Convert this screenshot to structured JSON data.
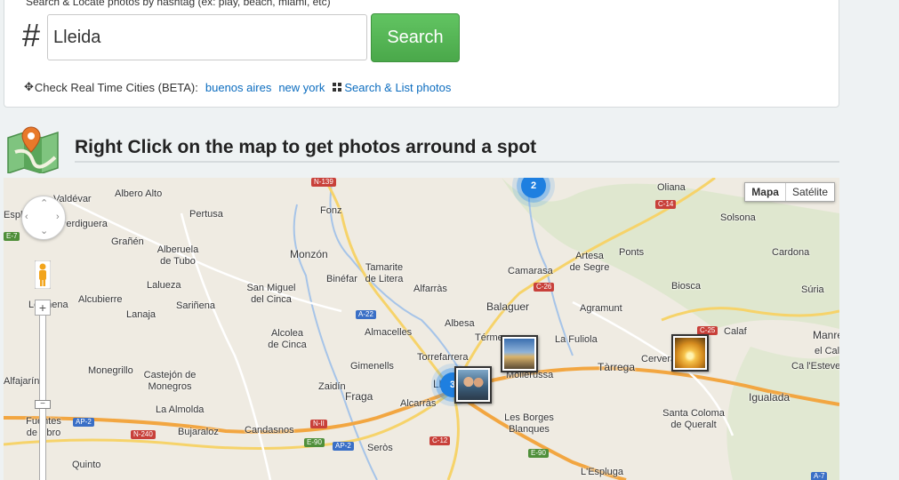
{
  "search": {
    "hint": "Search & Locate photos by hashtag (ex: play, beach, miami, etc)",
    "hash_symbol": "#",
    "value": "Lleida",
    "button": "Search"
  },
  "cities": {
    "label": "Check Real Time Cities (BETA):",
    "items": [
      "buenos aires",
      "new york"
    ],
    "list_link": "Search & List photos"
  },
  "section": {
    "title": "Right Click on the map to get photos arround a spot"
  },
  "map": {
    "type_buttons": [
      "Mapa",
      "Satélite"
    ],
    "zoom_in": "+",
    "zoom_out": "−",
    "places": [
      "Albero Alto",
      "Pertusa",
      "Fonz",
      "Oliana",
      "Solsona",
      "Grañén",
      "Alberuela de Tubo",
      "Monzón",
      "Tamarite de Litera",
      "Camarasa",
      "Artesa de Segre",
      "Ponts",
      "Cardona",
      "Lalueza",
      "San Miguel del Cinca",
      "Binéfar",
      "Alfarràs",
      "Biosca",
      "Súria",
      "Alcubierre",
      "Lanaja",
      "Sariñena",
      "Balaguer",
      "Agramunt",
      "Albesa",
      "Alcolea de Cinca",
      "Almacelles",
      "Térmens",
      "La Fuliola",
      "Calaf",
      "Manresa",
      "Torrefarrera",
      "Monegrillo",
      "Castejón de Monegros",
      "Gimenells",
      "Mollerussa",
      "Tàrrega",
      "Cervera",
      "el Calvet",
      "Ca l'Esteve",
      "Alfajarín",
      "Zaidín",
      "Lleida",
      "Igualada",
      "Alcarràs",
      "La Almolda",
      "Fraga",
      "Les Borges Blanques",
      "Santa Coloma de Queralt",
      "Fuentes de Ebro",
      "Bujaraloz",
      "Candasnos",
      "Seròs",
      "Quinto",
      "L'Espluga",
      "Leciñena",
      "Perdiguera",
      "Esplugues",
      "Valdévar"
    ],
    "roads": [
      "N-139",
      "C-14",
      "E-7",
      "C-26",
      "A-22",
      "C-25",
      "N-II",
      "AP-2",
      "E-90",
      "C-12",
      "A-7",
      "N-240"
    ],
    "clusters": [
      "2",
      "3"
    ],
    "photos": [
      "pier-sunset",
      "couple-selfie",
      "golden-sunset"
    ]
  },
  "colors": {
    "accent": "#5cb85c",
    "link": "#0b6cbf",
    "cluster": "#1e7fe0",
    "highway": "#f2a641"
  }
}
